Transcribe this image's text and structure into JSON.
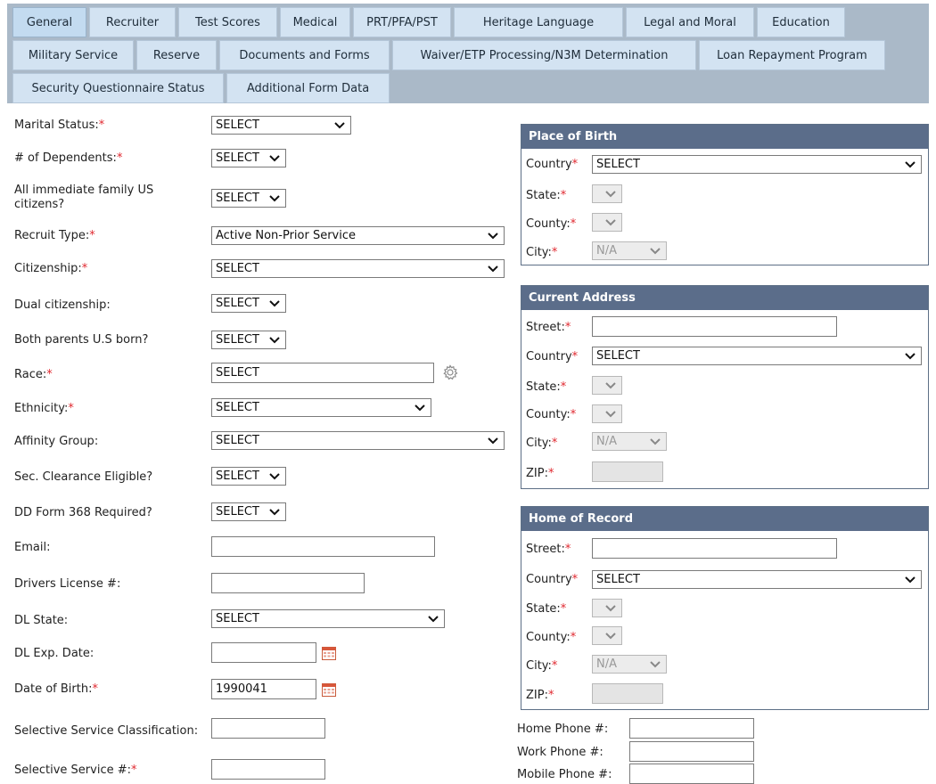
{
  "tabs": [
    "General",
    "Recruiter",
    "Test Scores",
    "Medical",
    "PRT/PFA/PST",
    "Heritage Language",
    "Legal and Moral",
    "Education",
    "Military Service",
    "Reserve",
    "Documents and Forms",
    "Waiver/ETP Processing/N3M Determination",
    "Loan Repayment Program",
    "Security Questionnaire Status",
    "Additional Form Data"
  ],
  "active_tab": "General",
  "required_marker": "*",
  "form": {
    "marital_status": {
      "label": "Marital Status:",
      "value": "SELECT"
    },
    "dependents": {
      "label": "# of Dependents:",
      "value": "SELECT"
    },
    "family_citizens": {
      "label": "All immediate family US citizens?",
      "value": "SELECT"
    },
    "recruit_type": {
      "label": "Recruit Type:",
      "value": "Active Non-Prior Service"
    },
    "citizenship": {
      "label": "Citizenship:",
      "value": "SELECT"
    },
    "dual_citizenship": {
      "label": "Dual citizenship:",
      "value": "SELECT"
    },
    "parents_born": {
      "label": "Both parents U.S born?",
      "value": "SELECT"
    },
    "race": {
      "label": "Race:",
      "value": "SELECT"
    },
    "ethnicity": {
      "label": "Ethnicity:",
      "value": "SELECT"
    },
    "affinity_group": {
      "label": "Affinity Group:",
      "value": "SELECT"
    },
    "sec_clearance": {
      "label": "Sec. Clearance Eligible?",
      "value": "SELECT"
    },
    "dd368": {
      "label": "DD Form 368 Required?",
      "value": "SELECT"
    },
    "email": {
      "label": "Email:",
      "value": ""
    },
    "dl_number": {
      "label": "Drivers License #:",
      "value": ""
    },
    "dl_state": {
      "label": "DL State:",
      "value": "SELECT"
    },
    "dl_exp": {
      "label": "DL Exp. Date:",
      "value": ""
    },
    "dob": {
      "label": "Date of Birth:",
      "value": "1990041"
    },
    "ss_class": {
      "label": "Selective Service Classification:",
      "value": ""
    },
    "ss_number": {
      "label": "Selective Service #:",
      "value": ""
    }
  },
  "place_of_birth": {
    "title": "Place of Birth",
    "country_label": "Country",
    "country_value": "SELECT",
    "state_label": "State:",
    "county_label": "County:",
    "city_label": "City:",
    "city_value": "N/A"
  },
  "current_address": {
    "title": "Current Address",
    "street_label": "Street:",
    "country_label": "Country",
    "country_value": "SELECT",
    "state_label": "State:",
    "county_label": "County:",
    "city_label": "City:",
    "city_value": "N/A",
    "zip_label": "ZIP:"
  },
  "home_of_record": {
    "title": "Home of Record",
    "street_label": "Street:",
    "country_label": "Country",
    "country_value": "SELECT",
    "state_label": "State:",
    "county_label": "County:",
    "city_label": "City:",
    "city_value": "N/A",
    "zip_label": "ZIP:"
  },
  "phones": {
    "home_label": "Home Phone #:",
    "work_label": "Work Phone #:",
    "mobile_label": "Mobile Phone #:"
  },
  "icons": {
    "gear": "gear-icon",
    "calendar": "calendar-icon",
    "chevron": "chevron-down-icon"
  }
}
